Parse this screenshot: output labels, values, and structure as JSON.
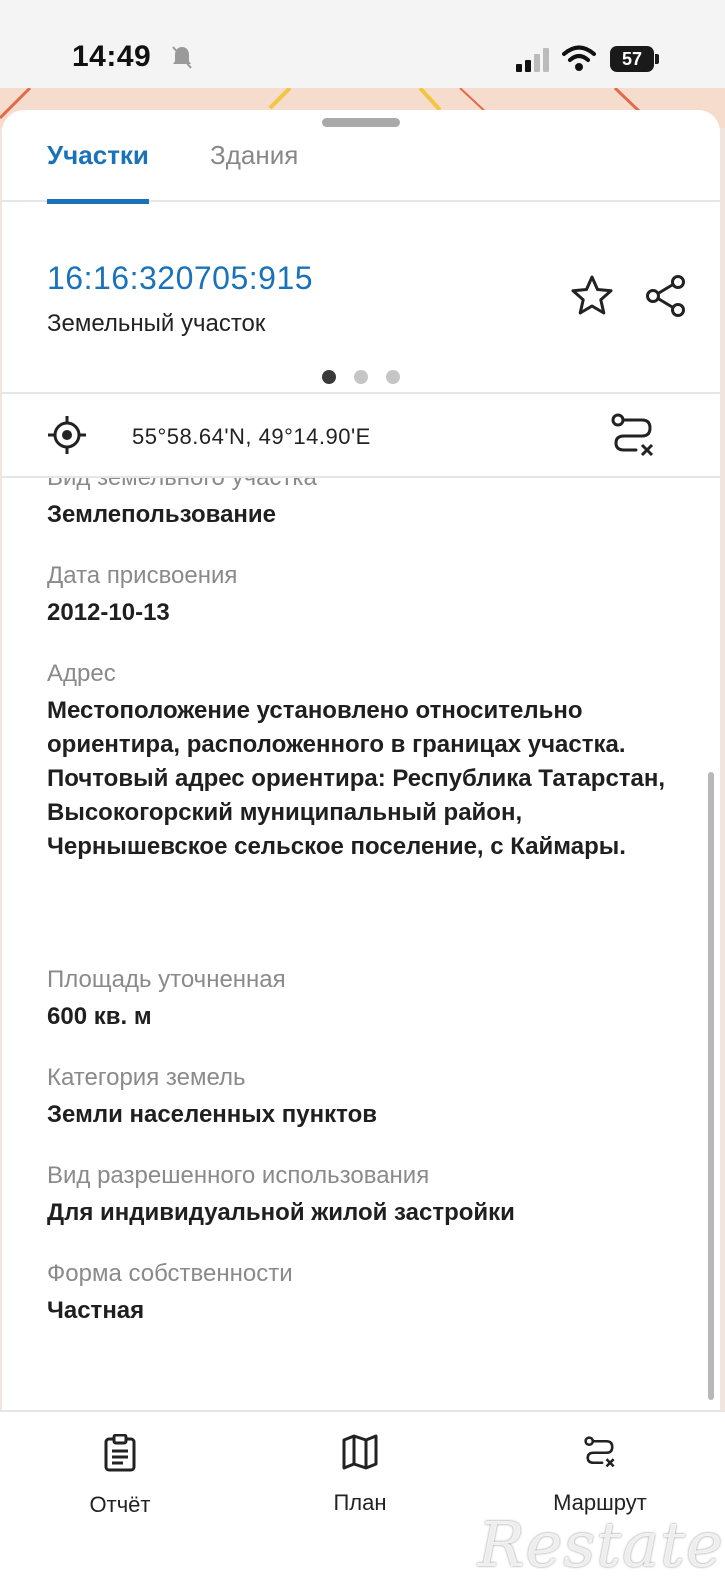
{
  "status_bar": {
    "time": "14:49",
    "battery": "57"
  },
  "tabs": [
    {
      "label": "Участки",
      "active": true
    },
    {
      "label": "Здания",
      "active": false
    }
  ],
  "parcel": {
    "cadastral_number": "16:16:320705:915",
    "type": "Земельный участок",
    "carousel_pages": 3,
    "carousel_active": 1
  },
  "location": {
    "coordinates": "55°58.64'N, 49°14.90'E"
  },
  "details": [
    {
      "label": "Вид земельного участка",
      "value": "Землепользование"
    },
    {
      "label": "Дата присвоения",
      "value": "2012-10-13"
    },
    {
      "label": "Адрес",
      "value": "Местоположение установлено относительно ориентира, расположенного в границах участка. Почтовый адрес ориентира: Республика Татарстан, Высокогорский муниципальный район, Чернышевское сельское поселение, с Каймары."
    },
    {
      "label": "Площадь уточненная",
      "value": "600 кв. м"
    },
    {
      "label": "Категория земель",
      "value": "Земли населенных пунктов"
    },
    {
      "label": "Вид разрешенного использования",
      "value": "Для индивидуальной жилой застройки"
    },
    {
      "label": "Форма собственности",
      "value": "Частная"
    }
  ],
  "bottom_nav": {
    "report_label": "Отчёт",
    "plan_label": "План",
    "route_label": "Маршрут"
  },
  "watermark": "Restate",
  "colors": {
    "accent": "#1a73b8",
    "label_gray": "#8a8a8a"
  }
}
